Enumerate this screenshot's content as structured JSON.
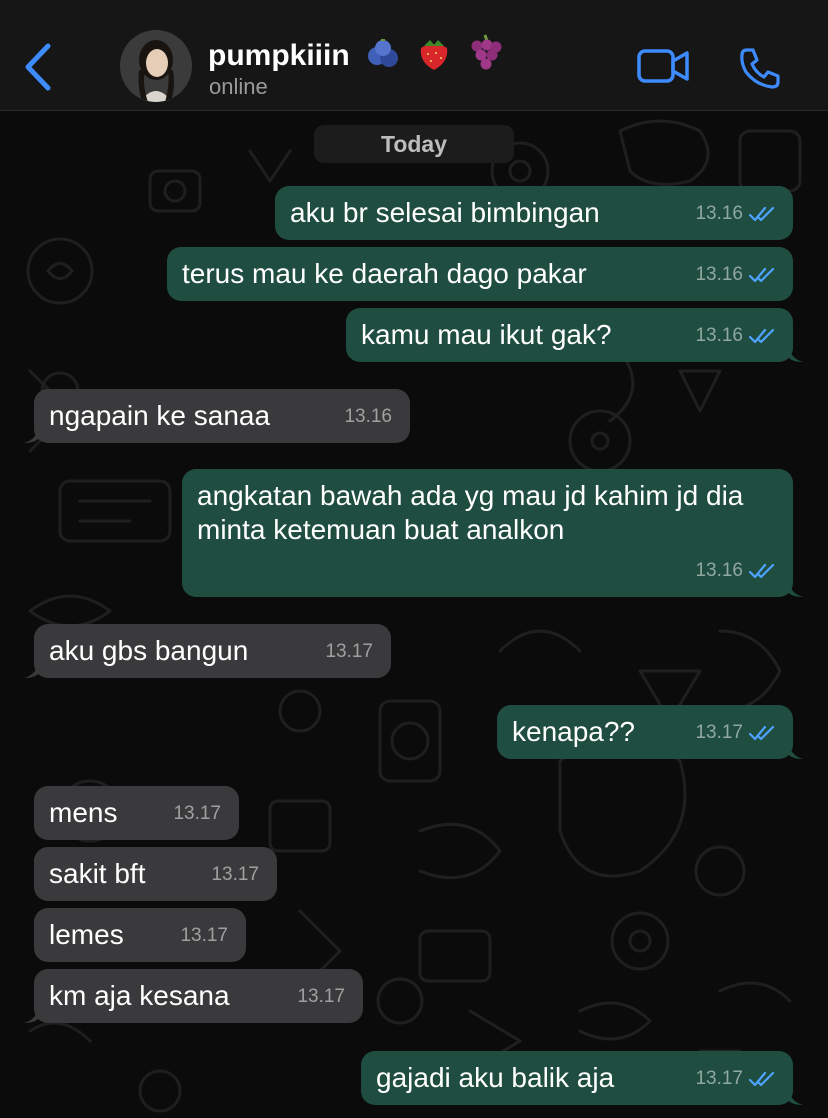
{
  "header": {
    "contact_name": "pumpkiiin",
    "status": "online",
    "emoji_icons": [
      "blueberries-icon",
      "strawberry-icon",
      "grapes-icon"
    ],
    "accent_color": "#3d8bfd"
  },
  "chat": {
    "date_label": "Today",
    "colors": {
      "outgoing": "#1f4d40",
      "incoming": "#3a3a3c",
      "read_ticks": "#4fa3ff"
    },
    "messages": [
      {
        "dir": "out",
        "text": "aku br selesai bimbingan",
        "time": "13.16"
      },
      {
        "dir": "out",
        "text": "terus mau ke daerah dago pakar",
        "time": "13.16"
      },
      {
        "dir": "out",
        "text": "kamu mau ikut gak?",
        "time": "13.16"
      },
      {
        "dir": "in",
        "text": "ngapain ke sanaa",
        "time": "13.16"
      },
      {
        "dir": "out",
        "text": "angkatan bawah ada yg mau jd kahim jd dia minta ketemuan buat analkon",
        "time": "13.16"
      },
      {
        "dir": "in",
        "text": "aku gbs bangun",
        "time": "13.17"
      },
      {
        "dir": "out",
        "text": "kenapa??",
        "time": "13.17"
      },
      {
        "dir": "in",
        "text": "mens",
        "time": "13.17"
      },
      {
        "dir": "in",
        "text": "sakit bft",
        "time": "13.17"
      },
      {
        "dir": "in",
        "text": "lemes",
        "time": "13.17"
      },
      {
        "dir": "in",
        "text": "km aja kesana",
        "time": "13.17"
      },
      {
        "dir": "out",
        "text": "gajadi aku balik aja",
        "time": "13.17"
      }
    ]
  }
}
